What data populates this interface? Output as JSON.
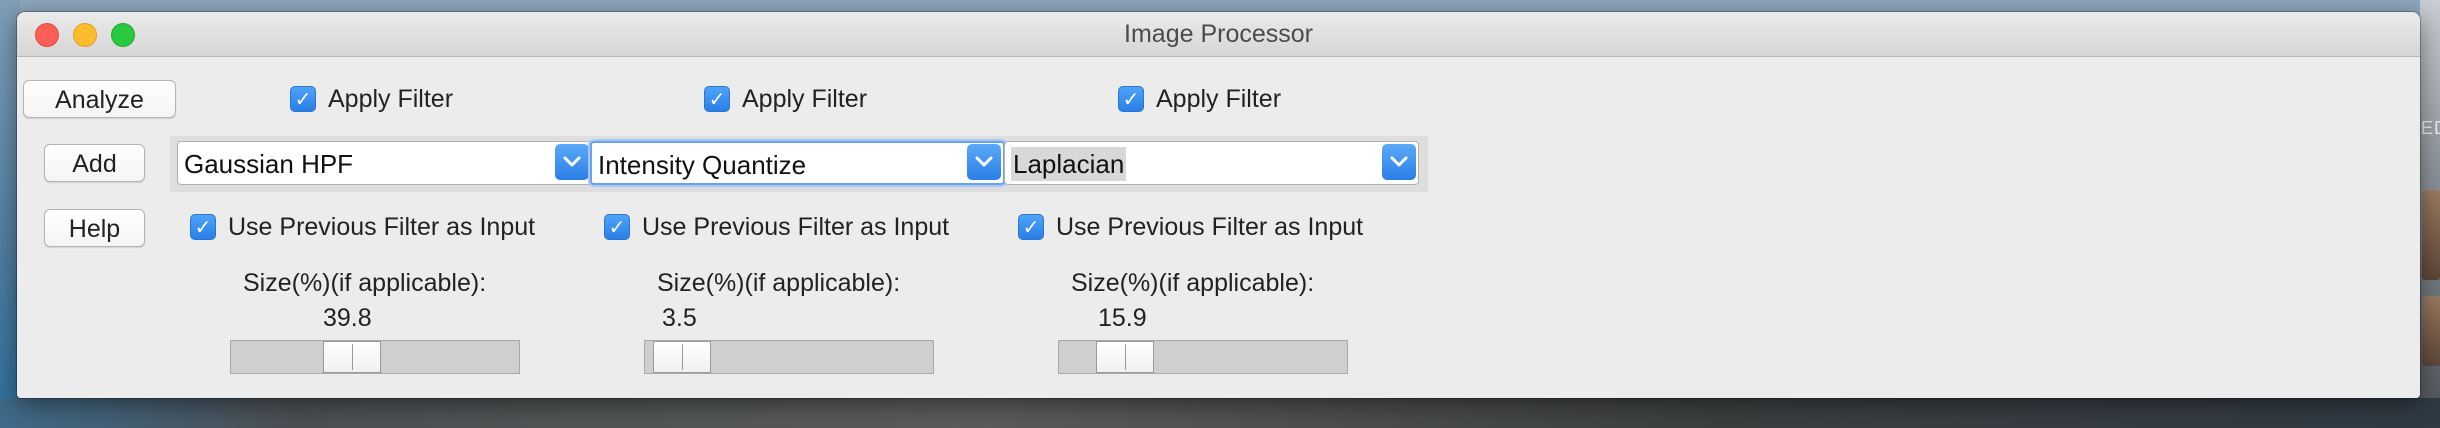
{
  "window": {
    "title": "Image Processor"
  },
  "desktop": {
    "right_edge_text": "ED"
  },
  "buttons": {
    "analyze": "Analyze",
    "add": "Add",
    "help": "Help"
  },
  "columns": [
    {
      "apply_filter": {
        "label": "Apply Filter",
        "checked": true
      },
      "filter": {
        "selected": "Gaussian HPF"
      },
      "use_previous": {
        "label": "Use Previous Filter as Input",
        "checked": true
      },
      "size": {
        "label": "Size(%)(if applicable):",
        "value": "39.8"
      }
    },
    {
      "apply_filter": {
        "label": "Apply Filter",
        "checked": true
      },
      "filter": {
        "selected": "Intensity Quantize"
      },
      "use_previous": {
        "label": "Use Previous Filter as Input",
        "checked": true
      },
      "size": {
        "label": "Size(%)(if applicable):",
        "value": "3.5"
      }
    },
    {
      "apply_filter": {
        "label": "Apply Filter",
        "checked": true
      },
      "filter": {
        "selected": "Laplacian"
      },
      "use_previous": {
        "label": "Use Previous Filter as Input",
        "checked": true
      },
      "size": {
        "label": "Size(%)(if applicable):",
        "value": "15.9"
      }
    }
  ],
  "icons": {
    "window_close": "close-icon",
    "window_minimize": "minimize-icon",
    "window_maximize": "maximize-icon",
    "checkbox_check": "checkmark-icon",
    "combo_arrow": "chevron-down-icon"
  },
  "colors": {
    "accent": "#2a7fe8",
    "close": "#fc5f57",
    "minimize": "#fdbc2e",
    "maximize": "#28c840"
  }
}
